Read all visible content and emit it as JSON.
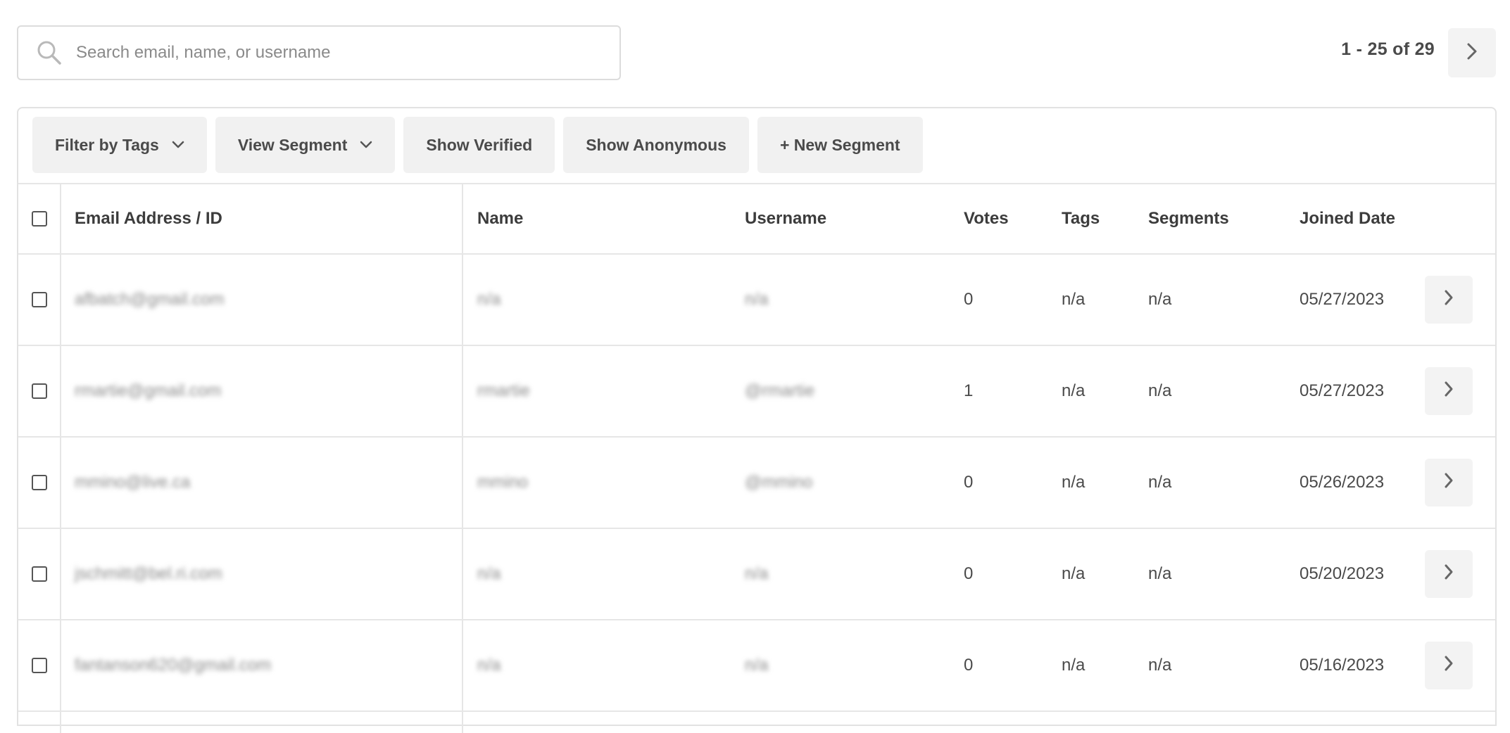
{
  "search": {
    "placeholder": "Search email, name, or username",
    "icon": "search-icon"
  },
  "pagination": {
    "range_text": "1 - 25 of 29",
    "next_icon": "chevron-right-icon"
  },
  "toolbar": {
    "filter_by_tags": "Filter by Tags",
    "view_segment": "View Segment",
    "show_verified": "Show Verified",
    "show_anonymous": "Show Anonymous",
    "new_segment": "+ New Segment"
  },
  "table": {
    "headers": {
      "email": "Email Address / ID",
      "name": "Name",
      "username": "Username",
      "votes": "Votes",
      "tags": "Tags",
      "segments": "Segments",
      "joined": "Joined Date"
    },
    "rows": [
      {
        "email": "afbatch@gmail.com",
        "name": "n/a",
        "username": "n/a",
        "votes": "0",
        "tags": "n/a",
        "segments": "n/a",
        "joined": "05/27/2023"
      },
      {
        "email": "rmartie@gmail.com",
        "name": "rmartie",
        "username": "@rmartie",
        "votes": "1",
        "tags": "n/a",
        "segments": "n/a",
        "joined": "05/27/2023"
      },
      {
        "email": "mmino@live.ca",
        "name": "mmino",
        "username": "@mmino",
        "votes": "0",
        "tags": "n/a",
        "segments": "n/a",
        "joined": "05/26/2023"
      },
      {
        "email": "jschmitt@bel.ri.com",
        "name": "n/a",
        "username": "n/a",
        "votes": "0",
        "tags": "n/a",
        "segments": "n/a",
        "joined": "05/20/2023"
      },
      {
        "email": "fantanson620@gmail.com",
        "name": "n/a",
        "username": "n/a",
        "votes": "0",
        "tags": "n/a",
        "segments": "n/a",
        "joined": "05/16/2023"
      }
    ]
  },
  "colors": {
    "button_bg": "#f1f1f1",
    "border": "#e2e2e2",
    "text": "#4a4a4a"
  }
}
